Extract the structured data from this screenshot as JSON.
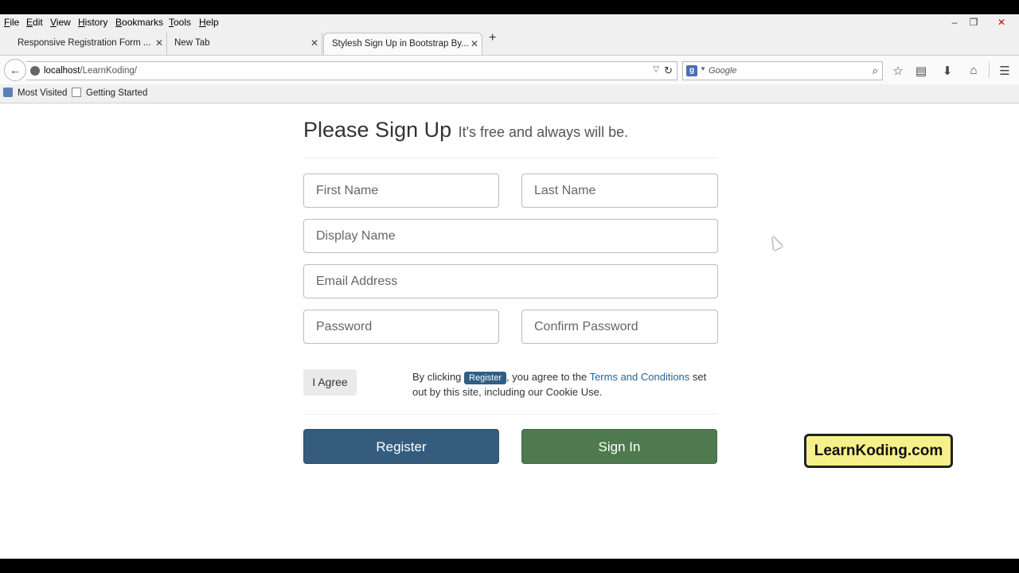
{
  "menubar": {
    "items": [
      "File",
      "Edit",
      "View",
      "History",
      "Bookmarks",
      "Tools",
      "Help"
    ],
    "minimize": "–",
    "restore": "❐",
    "close": "✕"
  },
  "tabs": [
    {
      "label": "Responsive Registration Form ...",
      "active": false
    },
    {
      "label": "New Tab",
      "active": false
    },
    {
      "label": "Stylesh Sign Up in Bootstrap By...",
      "active": true
    }
  ],
  "navbar": {
    "url_host": "localhost",
    "url_path": "/LearnKoding/",
    "search_placeholder": "Google",
    "search_engine_letter": "g"
  },
  "bookmarks": [
    {
      "label": "Most Visited",
      "icon": "most-visited-icon"
    },
    {
      "label": "Getting Started",
      "icon": "page-icon"
    }
  ],
  "form": {
    "heading": "Please Sign Up",
    "subheading": "It's free and always will be.",
    "first_name_placeholder": "First Name",
    "last_name_placeholder": "Last Name",
    "display_name_placeholder": "Display Name",
    "email_placeholder": "Email Address",
    "password_placeholder": "Password",
    "confirm_password_placeholder": "Confirm Password",
    "agree_label": "I Agree",
    "terms_prefix": "By clicking ",
    "terms_badge": "Register",
    "terms_middle": ", you agree to the ",
    "terms_link": "Terms and Conditions",
    "terms_suffix": " set out by this site, including our Cookie Use.",
    "register_label": "Register",
    "signin_label": "Sign In"
  },
  "watermark": "LearnKoding.com",
  "colors": {
    "register_button": "#355c7d",
    "signin_button": "#4f7a4f",
    "link": "#2a6496",
    "watermark_bg": "#f6f08a"
  }
}
